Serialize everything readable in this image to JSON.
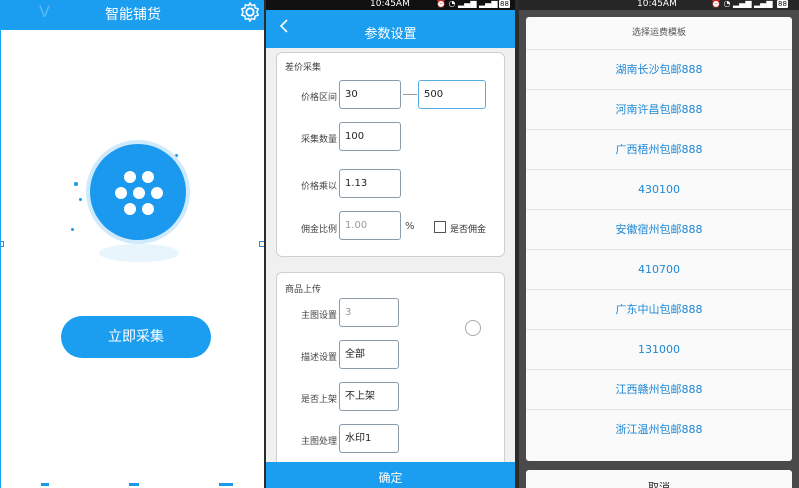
{
  "screen1": {
    "title": "智能铺货",
    "collect_button": "立即采集",
    "icons": [
      "gear-icon",
      "flower-dots-icon"
    ]
  },
  "screen2": {
    "status_time": "10:45AM",
    "status_battery": "88",
    "header_title": "参数设置",
    "back_icon": "chevron-left-icon",
    "price_section": {
      "title": "差价采集",
      "range_label": "价格区间",
      "range_min": "30",
      "range_max": "500",
      "count_label": "采集数量",
      "count_value": "100",
      "multiply_label": "价格乘以",
      "multiply_value": "1.13",
      "commission_label": "佣金比例",
      "commission_placeholder": "1.00",
      "percent": "%",
      "commission_check_label": "是否佣金"
    },
    "upload_section": {
      "title": "商品上传",
      "main_image_label": "主图设置",
      "main_image_value": "3",
      "desc_label": "描述设置",
      "desc_value": "全部",
      "listing_label": "是否上架",
      "listing_value": "不上架",
      "image_process_label": "主图处理",
      "image_process_value": "水印1"
    },
    "confirm_button": "确定"
  },
  "screen3": {
    "status_time": "10:45AM",
    "status_battery": "88",
    "sheet_title": "选择运费模板",
    "templates": [
      "湖南长沙包邮888",
      "河南许昌包邮888",
      "广西梧州包邮888",
      "430100",
      "安徽宿州包邮888",
      "410700",
      "广东中山包邮888",
      "131000",
      "江西赣州包邮888",
      "浙江温州包邮888"
    ],
    "cancel_button": "取消"
  },
  "colors": {
    "primary": "#1b9ef0",
    "item_text": "#1e88d6"
  }
}
